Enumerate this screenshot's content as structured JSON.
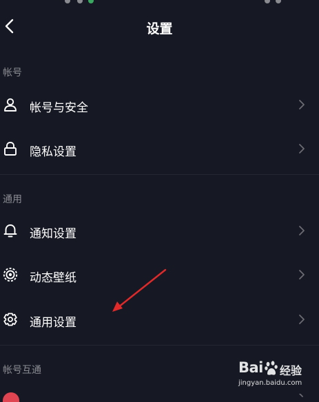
{
  "header": {
    "title": "设置",
    "back_icon": "chevron-left-icon"
  },
  "sections": [
    {
      "title": "帐号"
    },
    {
      "title": "通用"
    },
    {
      "title": "帐号互通"
    }
  ],
  "rows": [
    {
      "label": "帐号与安全",
      "icon": "user-icon"
    },
    {
      "label": "隐私设置",
      "icon": "lock-icon"
    },
    {
      "label": "通知设置",
      "icon": "bell-icon"
    },
    {
      "label": "动态壁纸",
      "icon": "wallpaper-icon"
    },
    {
      "label": "通用设置",
      "icon": "gear-icon"
    }
  ],
  "partial_row": {
    "icon": "app-icon",
    "icon_color": "#e04450"
  },
  "colors": {
    "background": "#161823",
    "text": "#ffffff",
    "section_text": "#8b8c93",
    "chevron": "#6b6c73",
    "divider": "#242632",
    "annotation_arrow": "#e02a2a"
  },
  "watermark": {
    "brand": "Bai",
    "brand2": "经验",
    "url": "jingyan.baidu.com"
  }
}
